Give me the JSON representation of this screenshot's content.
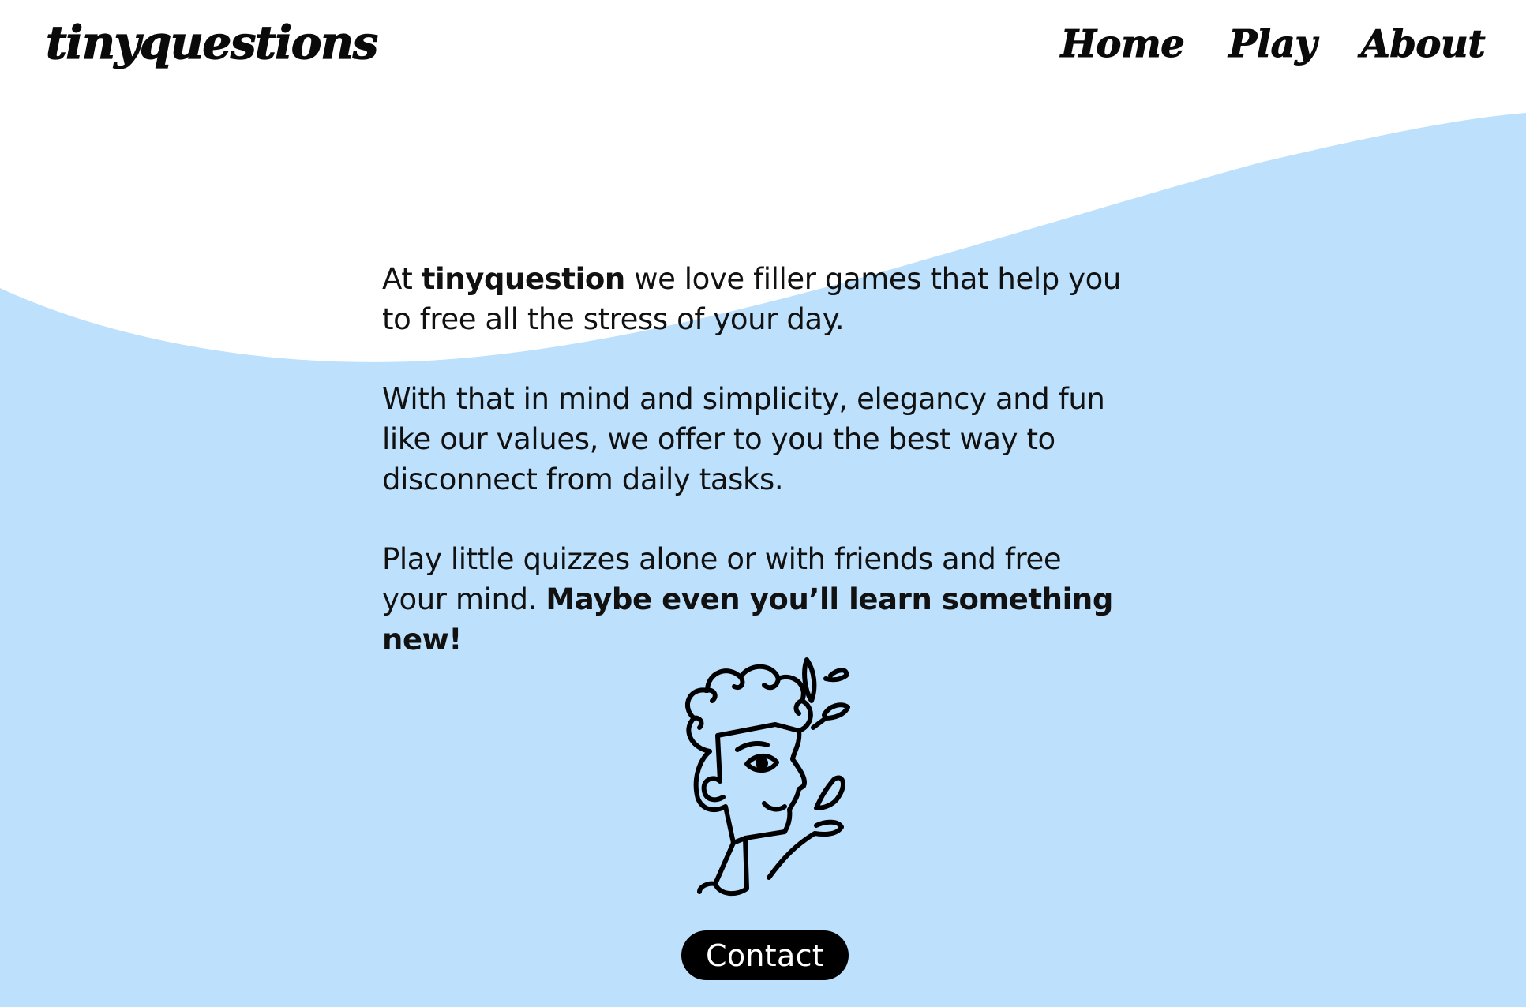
{
  "colors": {
    "background": "#ffffff",
    "wave": "#bde0fc",
    "text": "#111111",
    "button_bg": "#000000",
    "button_text": "#ffffff"
  },
  "header": {
    "logo": "tinyquestions",
    "nav": [
      {
        "label": "Home"
      },
      {
        "label": "Play"
      },
      {
        "label": "About"
      }
    ]
  },
  "main": {
    "p1": {
      "before": "At ",
      "brand": "tinyquestion",
      "after": " we love filler games that help you to free all the stress of your day."
    },
    "p2": "With that in mind and simplicity, elegancy and fun like our values, we offer to you the best way to disconnect from daily tasks.",
    "p3": {
      "before": "Play little quizzes alone or with friends and free your mind. ",
      "bold": "Maybe even you’ll learn something new!"
    },
    "illustration_icon": "head-with-splashes-icon"
  },
  "contact": {
    "label": "Contact"
  }
}
